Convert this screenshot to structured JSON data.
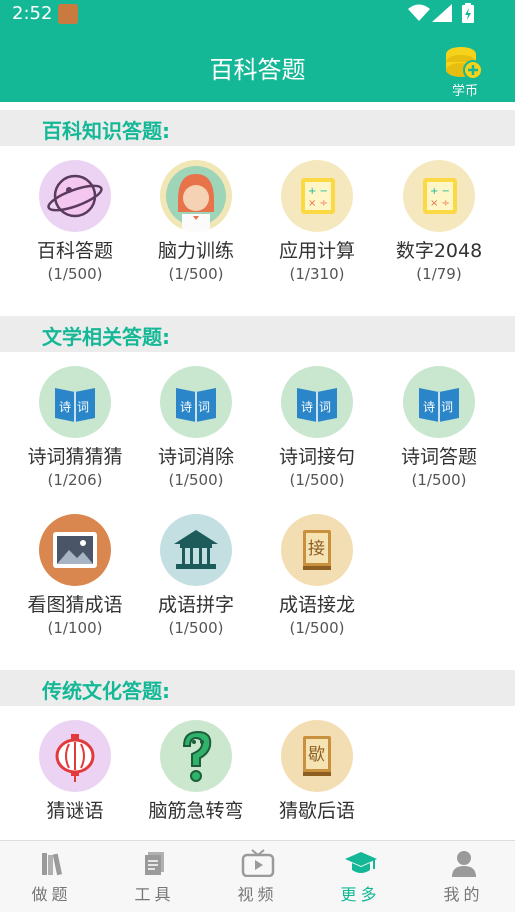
{
  "status": {
    "time": "2:52"
  },
  "header": {
    "title": "百科答题",
    "coin_label": "学币"
  },
  "sections": [
    {
      "title": "百科知识答题:",
      "items": [
        {
          "name": "百科答题",
          "count": "(1/500)",
          "icon": "planet-icon"
        },
        {
          "name": "脑力训练",
          "count": "(1/500)",
          "icon": "girl-avatar-icon"
        },
        {
          "name": "应用计算",
          "count": "(1/310)",
          "icon": "math-board-icon"
        },
        {
          "name": "数字2048",
          "count": "(1/79)",
          "icon": "math-board-icon"
        }
      ]
    },
    {
      "title": "文学相关答题:",
      "items": [
        {
          "name": "诗词猜猜猜",
          "count": "(1/206)",
          "icon": "poem-book-icon"
        },
        {
          "name": "诗词消除",
          "count": "(1/500)",
          "icon": "poem-book-icon"
        },
        {
          "name": "诗词接句",
          "count": "(1/500)",
          "icon": "poem-book-icon"
        },
        {
          "name": "诗词答题",
          "count": "(1/500)",
          "icon": "poem-book-icon"
        },
        {
          "name": "看图猜成语",
          "count": "(1/100)",
          "icon": "picture-icon"
        },
        {
          "name": "成语拼字",
          "count": "(1/500)",
          "icon": "pavilion-icon"
        },
        {
          "name": "成语接龙",
          "count": "(1/500)",
          "icon": "jie-book-icon"
        }
      ]
    },
    {
      "title": "传统文化答题:",
      "items": [
        {
          "name": "猜谜语",
          "icon": "lantern-icon"
        },
        {
          "name": "脑筋急转弯",
          "icon": "question-mark-icon"
        },
        {
          "name": "猜歇后语",
          "icon": "xie-book-icon"
        }
      ]
    }
  ],
  "icon_text": {
    "poem": "诗",
    "ci": "词",
    "jie": "接",
    "xie": "歇"
  },
  "tabs": [
    {
      "label": "做题",
      "icon": "books-icon",
      "active": false
    },
    {
      "label": "工具",
      "icon": "document-icon",
      "active": false
    },
    {
      "label": "视频",
      "icon": "tv-play-icon",
      "active": false
    },
    {
      "label": "更多",
      "icon": "graduation-cap-icon",
      "active": true
    },
    {
      "label": "我的",
      "icon": "person-icon",
      "active": false
    }
  ],
  "colors": {
    "primary": "#15b896",
    "section_bg": "#ececec",
    "tab_inactive": "#777777"
  }
}
